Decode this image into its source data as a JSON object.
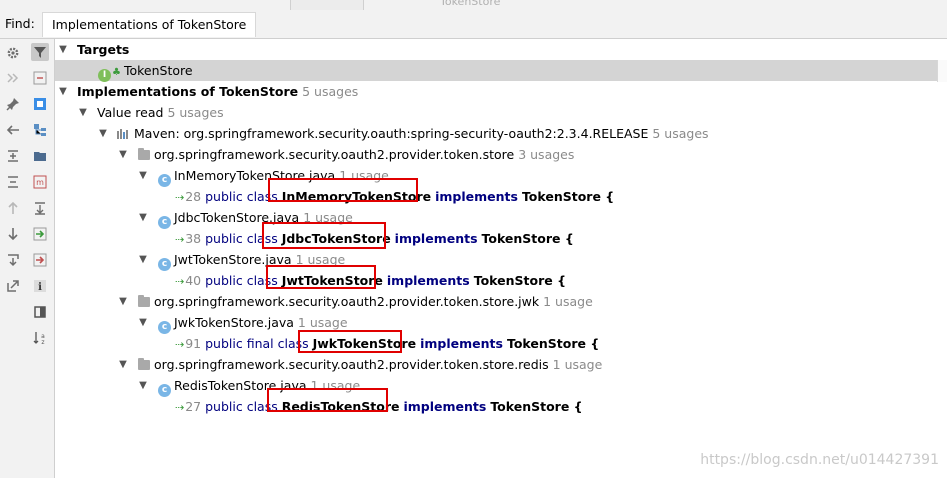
{
  "top": {
    "ghost_title": "TokenStore"
  },
  "find": {
    "label": "Find:",
    "tab_title": "Implementations of TokenStore"
  },
  "toolbar_icons": {
    "left": [
      "gear-icon",
      "double-arrow-icon",
      "pin-icon",
      "arrow-left-icon",
      "expand-all-icon",
      "collapse-all-icon",
      "arrow-up-icon",
      "arrow-down-icon",
      "export-icon",
      "open-external-icon"
    ],
    "right": [
      "filter-icon",
      "merge-icon",
      "select-icon",
      "group-by-module-icon",
      "group-by-directory-icon",
      "method-icon",
      "scroll-to-source-icon",
      "navigate-next-icon",
      "navigate-prev-icon",
      "info-icon",
      "preview-icon",
      "sort-az-icon"
    ]
  },
  "tree": {
    "targets_label": "Targets",
    "target_item": "TokenStore",
    "impl_label": "Implementations of TokenStore",
    "impl_count": "5 usages",
    "value_read_label": "Value read",
    "value_read_count": "5 usages",
    "maven_label": "Maven: org.springframework.security.oauth:spring-security-oauth2:2.3.4.RELEASE",
    "maven_count": "5 usages",
    "packages": [
      {
        "name": "org.springframework.security.oauth2.provider.token.store",
        "count": "3 usages",
        "files": [
          {
            "file": "InMemoryTokenStore.java",
            "count": "1 usage",
            "line": "28",
            "pre": "public class ",
            "cls": "InMemoryTokenStore",
            "impl": "implements",
            "iface": "TokenStore {"
          },
          {
            "file": "JdbcTokenStore.java",
            "count": "1 usage",
            "line": "38",
            "pre": "public class ",
            "cls": "JdbcTokenStore",
            "impl": "implements",
            "iface": "TokenStore {"
          },
          {
            "file": "JwtTokenStore.java",
            "count": "1 usage",
            "line": "40",
            "pre": "public class ",
            "cls": "JwtTokenStore",
            "impl": "implements",
            "iface": "TokenStore {"
          }
        ]
      },
      {
        "name": "org.springframework.security.oauth2.provider.token.store.jwk",
        "count": "1 usage",
        "files": [
          {
            "file": "JwkTokenStore.java",
            "count": "1 usage",
            "line": "91",
            "pre": "public final class ",
            "cls": "JwkTokenStore",
            "impl": "implements",
            "iface": "TokenStore {"
          }
        ]
      },
      {
        "name": "org.springframework.security.oauth2.provider.token.store.redis",
        "count": "1 usage",
        "files": [
          {
            "file": "RedisTokenStore.java",
            "count": "1 usage",
            "line": "27",
            "pre": "public class ",
            "cls": "RedisTokenStore",
            "impl": "implements",
            "iface": "TokenStore {"
          }
        ]
      }
    ]
  },
  "watermark": "https://blog.csdn.net/u014427391",
  "colors": {
    "highlight_box": "#e00000",
    "keyword": "#00007f",
    "selection": "#d4d4d4"
  }
}
